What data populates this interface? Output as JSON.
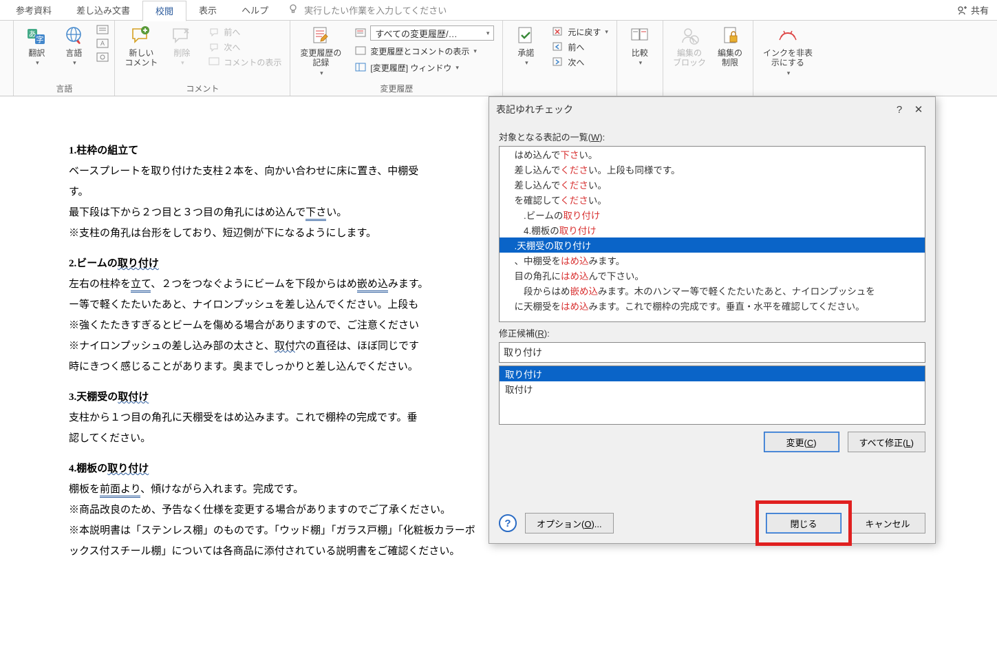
{
  "tabs": {
    "references": "参考資料",
    "mailings": "差し込み文書",
    "review": "校閲",
    "view": "表示",
    "help": "ヘルプ",
    "tell_me": "実行したい作業を入力してください",
    "share": "共有"
  },
  "ribbon": {
    "language_group": "言語",
    "translate": "翻訳",
    "language": "言語",
    "comments_group": "コメント",
    "new_comment": "新しい\nコメント",
    "delete": "削除",
    "prev": "前へ",
    "next": "次へ",
    "show_comments": "コメントの表示",
    "tracking_group": "変更履歴",
    "track_changes": "変更履歴の\n記録",
    "display_for_review": "すべての変更履歴/…",
    "show_markup": "変更履歴とコメントの表示",
    "reviewing_pane": "[変更履歴] ウィンドウ",
    "accept": "承諾",
    "reject": "元に戻す",
    "prev2": "前へ",
    "next2": "次へ",
    "compare": "比較",
    "block_authors": "編集の\nブロック",
    "restrict_editing": "編集の\n制限",
    "ink_hide": "インクを非表\n示にする"
  },
  "doc": {
    "h1": "1.柱枠の組立て",
    "p1a": "ベースプレートを取り付けた支柱２本を、向かい合わせに床に置き、中棚受",
    "p1b": "す。",
    "p1c_a": "最下段は下から２つ目と３つ目の角孔にはめ込んで",
    "p1c_b": "下さ",
    "p1c_c": "い。",
    "p1d": "※支柱の角孔は台形をしており、短辺側が下になるようにします。",
    "h2": "2.ビームの",
    "h2u": "取り付け",
    "p2a_a": "左右の柱枠を",
    "p2a_b": "立て",
    "p2a_c": "、２つをつなぐようにビームを下段からはめ",
    "p2a_d": "嵌め込",
    "p2a_e": "みます。",
    "p2b": "ー等で軽くたたいたあと、ナイロンプッシュを差し込んでください。上段も",
    "p2c": "※強くたたきすぎるとビームを傷める場合がありますので、ご注意ください",
    "p2d_a": "※ナイロンプッシュの差し込み部の太さと、",
    "p2d_b": "取付",
    "p2d_c": "穴の直径は、ほぼ同じです",
    "p2e": "時にきつく感じることがあります。奥までしっかりと差し込んでください。",
    "h3": "3.天棚受の",
    "h3u": "取付け",
    "p3a": "支柱から１つ目の角孔に天棚受をはめ込みます。これで棚枠の完成です。垂",
    "p3b": "認してください。",
    "h4": "4.棚板の",
    "h4u": "取り付け",
    "p4a_a": "棚板を",
    "p4a_b": "前面より",
    "p4a_c": "、傾けながら入れます。完成です。",
    "p4b": "※商品改良のため、予告なく仕様を変更する場合がありますのでご了承ください。",
    "p4c": "※本説明書は「ステンレス棚」のものです。「ウッド棚」「ガラス戸棚」「化粧板カラーボ",
    "p4d": "ックス付スチール棚」については各商品に添付されている説明書をご確認ください。"
  },
  "dialog": {
    "title": "表記ゆれチェック",
    "list_label_pre": "対象となる表記の一覧(",
    "list_label_key": "W",
    "list_label_post": "):",
    "lines": [
      {
        "pre": "　はめ込んで",
        "hl": "下さ",
        "post": "い。"
      },
      {
        "pre": "　差し込んで",
        "hl": "くださ",
        "post": "い。上段も同様です。"
      },
      {
        "pre": "　差し込んで",
        "hl": "くださ",
        "post": "い。"
      },
      {
        "pre": "　を確認して",
        "hl": "くださ",
        "post": "い。"
      },
      {
        "pre": "　　.ビームの",
        "hl": "取り付け",
        "post": ""
      },
      {
        "pre": "　　4.棚板の",
        "hl": "取り付け",
        "post": ""
      },
      {
        "pre": "　.天棚受の",
        "hl": "取り付け",
        "post": "",
        "sel": true
      },
      {
        "pre": "　、中棚受を",
        "hl": "はめ込",
        "post": "みます。"
      },
      {
        "pre": "　目の角孔に",
        "hl": "はめ込",
        "post": "んで下さい。"
      },
      {
        "pre": "　　段からはめ",
        "hl": "嵌め込",
        "post": "みます。木のハンマー等で軽くたたいたあと、ナイロンプッシュを"
      },
      {
        "pre": "　に天棚受を",
        "hl": "はめ込",
        "post": "みます。これで棚枠の完成です。垂直・水平を確認してください。"
      }
    ],
    "cand_label_pre": "修正候補(",
    "cand_label_key": "R",
    "cand_label_post": "):",
    "cand_value": "取り付け",
    "cand_list": [
      "取り付け",
      "取付け"
    ],
    "btn_change": "変更(C)",
    "btn_change_all": "すべて修正(L)",
    "btn_options": "オプション(O)...",
    "btn_close": "閉じる",
    "btn_cancel": "キャンセル",
    "help": "?",
    "close_x": "✕"
  }
}
